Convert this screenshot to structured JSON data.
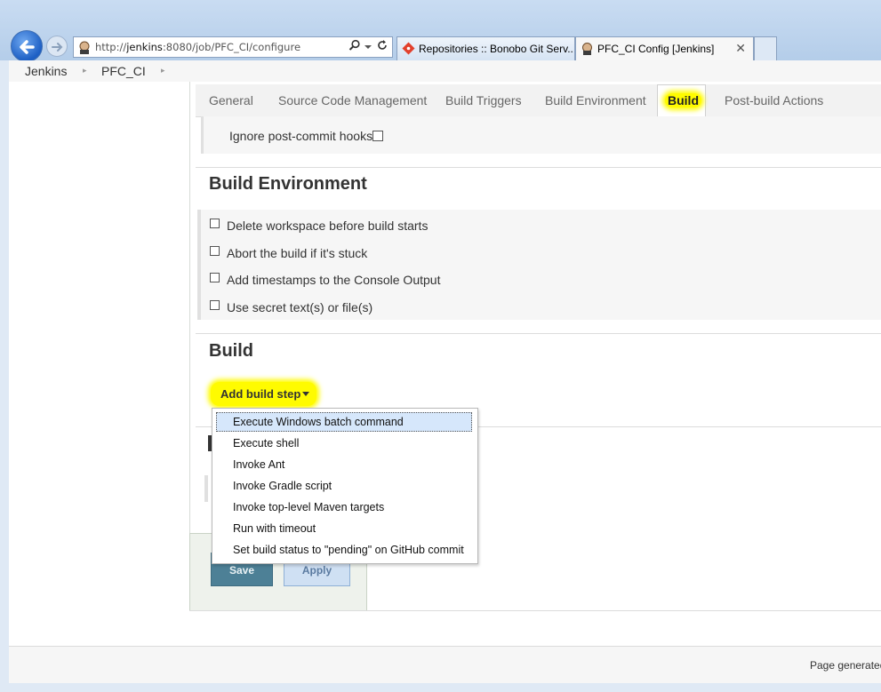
{
  "browser": {
    "address": {
      "url_prefix": "http://",
      "url_host": "jenkins",
      "url_rest": ":8080/job/PFC_CI/configure"
    },
    "tabs": [
      {
        "label": "Repositories :: Bonobo Git Serv..."
      },
      {
        "label": "PFC_CI Config [Jenkins]",
        "close": "✕"
      }
    ]
  },
  "breadcrumb": {
    "items": [
      "Jenkins",
      "PFC_CI"
    ],
    "separator": "▸"
  },
  "config_tabs": [
    "General",
    "Source Code Management",
    "Build Triggers",
    "Build Environment",
    "Build",
    "Post-build Actions"
  ],
  "triggers": {
    "ignore_hooks": "Ignore post-commit hooks"
  },
  "build_environment": {
    "title": "Build Environment",
    "options": [
      "Delete workspace before build starts",
      "Abort the build if it's stuck",
      "Add timestamps to the Console Output",
      "Use secret text(s) or file(s)"
    ]
  },
  "build": {
    "title": "Build",
    "add_step": "Add build step",
    "menu": [
      "Execute Windows batch command",
      "Execute shell",
      "Invoke Ant",
      "Invoke Gradle script",
      "Invoke top-level Maven targets",
      "Run with timeout",
      "Set build status to \"pending\" on GitHub commit"
    ]
  },
  "actions": {
    "save": "Save",
    "apply": "Apply"
  },
  "footer": {
    "text": "Page generated"
  },
  "colors": {
    "highlight": "#fffb00",
    "save_button": "#4d8096",
    "apply_button": "#cfe0f3"
  }
}
